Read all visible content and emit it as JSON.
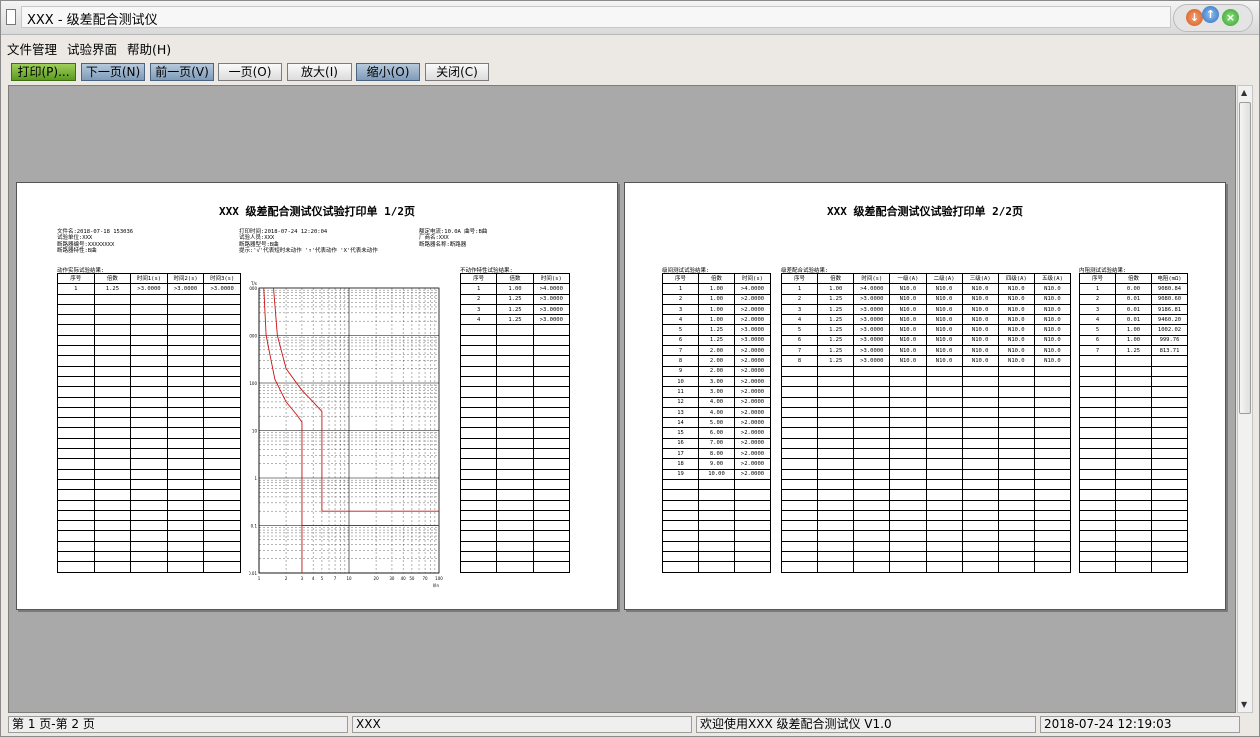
{
  "window": {
    "title": "XXX - 级差配合测试仪"
  },
  "menu": [
    "文件管理",
    "试验界面",
    "帮助(H)"
  ],
  "toolbar": {
    "print": "打印(P)...",
    "next": "下一页(N)",
    "prev": "前一页(V)",
    "one_page": "一页(O)",
    "zoom_in": "放大(I)",
    "zoom_out": "缩小(O)",
    "close": "关闭(C)"
  },
  "colors": {
    "green": "#5b9a22",
    "blue": "#7f9bb8",
    "curve": "#cc1111"
  },
  "page1": {
    "title": "XXX 级差配合测试仪试验打印单 1/2页",
    "info_left": [
      "文件名:2018-07-18 153036",
      "试验单位:XXX",
      "断路器编号:XXXXXXXX",
      "断路器特性:B曲"
    ],
    "info_mid": [
      "打印时间:2018-07-24 12:20:04",
      "试验人员:XXX",
      "断路器型号:B曲",
      "提示:'√'代表短时未动作 '↑'代表动作 'X'代表未动作"
    ],
    "info_right": [
      "额定电流:10.0A 曲号:B曲",
      "厂商名:XXX",
      "断路器名称:断路器"
    ],
    "act_caption": "动作实际试验结果:",
    "act_headers": [
      "序号",
      "倍数",
      "时间1(s)",
      "时间2(s)",
      "时间3(s)"
    ],
    "act_rows": [
      [
        "1",
        "1.25",
        ">3.0000",
        ">3.0000",
        ">3.0000"
      ]
    ],
    "nonact_caption": "不动作特性试验结果:",
    "nonact_headers": [
      "序号",
      "倍数",
      "时间(s)"
    ],
    "nonact_rows": [
      [
        "1",
        "1.00",
        ">4.0000"
      ],
      [
        "2",
        "1.25",
        ">3.0000"
      ],
      [
        "3",
        "1.25",
        ">3.0000"
      ],
      [
        "4",
        "1.25",
        ">3.0000"
      ]
    ],
    "chart_yticks": [
      "10000",
      "1000",
      "100",
      "10",
      "1",
      "0.1",
      "0.01"
    ],
    "chart_xticks": [
      "1",
      "2",
      "3",
      "4",
      "5",
      "7",
      "10",
      "20",
      "30",
      "40",
      "50",
      "70",
      "100"
    ],
    "chart_xunit": "I/In",
    "chart_yunit": "T/s"
  },
  "page2": {
    "title": "XXX 级差配合测试仪试验打印单 2/2页",
    "t1_caption": "级间测试试验结果:",
    "t1_headers": [
      "序号",
      "倍数",
      "时间(s)"
    ],
    "t1_rows": [
      [
        "1",
        "1.00",
        ">4.0000"
      ],
      [
        "2",
        "1.00",
        ">2.0000"
      ],
      [
        "3",
        "1.00",
        ">2.0000"
      ],
      [
        "4",
        "1.00",
        ">2.0000"
      ],
      [
        "5",
        "1.25",
        ">3.0000"
      ],
      [
        "6",
        "1.25",
        ">3.0000"
      ],
      [
        "7",
        "2.00",
        ">2.0000"
      ],
      [
        "8",
        "2.00",
        ">2.0000"
      ],
      [
        "9",
        "2.00",
        ">2.0000"
      ],
      [
        "10",
        "3.00",
        ">2.0000"
      ],
      [
        "11",
        "3.00",
        ">2.0000"
      ],
      [
        "12",
        "4.00",
        ">2.0000"
      ],
      [
        "13",
        "4.00",
        ">2.0000"
      ],
      [
        "14",
        "5.00",
        ">2.0000"
      ],
      [
        "15",
        "6.00",
        ">2.0000"
      ],
      [
        "16",
        "7.00",
        ">2.0000"
      ],
      [
        "17",
        "8.00",
        ">2.0000"
      ],
      [
        "18",
        "9.00",
        ">2.0000"
      ],
      [
        "19",
        "10.00",
        ">2.0000"
      ]
    ],
    "t2_caption": "级差配合试验结果:",
    "t2_headers": [
      "序号",
      "倍数",
      "时间(s)",
      "一级(A)",
      "二级(A)",
      "三级(A)",
      "四级(A)",
      "五级(A)"
    ],
    "t2_rows": [
      [
        "1",
        "1.00",
        ">4.0000",
        "N10.0",
        "N10.0",
        "N10.0",
        "N10.0",
        "N10.0"
      ],
      [
        "2",
        "1.25",
        ">3.0000",
        "N10.0",
        "N10.0",
        "N10.0",
        "N10.0",
        "N10.0"
      ],
      [
        "3",
        "1.25",
        ">3.0000",
        "N10.0",
        "N10.0",
        "N10.0",
        "N10.0",
        "N10.0"
      ],
      [
        "4",
        "1.25",
        ">3.0000",
        "N10.0",
        "N10.0",
        "N10.0",
        "N10.0",
        "N10.0"
      ],
      [
        "5",
        "1.25",
        ">3.0000",
        "N10.0",
        "N10.0",
        "N10.0",
        "N10.0",
        "N10.0"
      ],
      [
        "6",
        "1.25",
        ">3.0000",
        "N10.0",
        "N10.0",
        "N10.0",
        "N10.0",
        "N10.0"
      ],
      [
        "7",
        "1.25",
        ">3.0000",
        "N10.0",
        "N10.0",
        "N10.0",
        "N10.0",
        "N10.0"
      ],
      [
        "8",
        "1.25",
        ">3.0000",
        "N10.0",
        "N10.0",
        "N10.0",
        "N10.0",
        "N10.0"
      ]
    ],
    "t3_caption": "内阻测试试验结果:",
    "t3_headers": [
      "序号",
      "倍数",
      "电阻(mΩ)"
    ],
    "t3_rows": [
      [
        "1",
        "0.00",
        "9080.84"
      ],
      [
        "2",
        "0.01",
        "9080.60"
      ],
      [
        "3",
        "0.01",
        "9186.81"
      ],
      [
        "4",
        "0.01",
        "9460.20"
      ],
      [
        "5",
        "1.00",
        "1002.02"
      ],
      [
        "6",
        "1.00",
        "999.76"
      ],
      [
        "7",
        "1.25",
        "813.71"
      ]
    ]
  },
  "status": {
    "pages": "第 1 页-第 2 页",
    "company": "XXX",
    "welcome": "欢迎使用XXX 级差配合测试仪     V1.0",
    "datetime": "2018-07-24 12:19:03"
  }
}
